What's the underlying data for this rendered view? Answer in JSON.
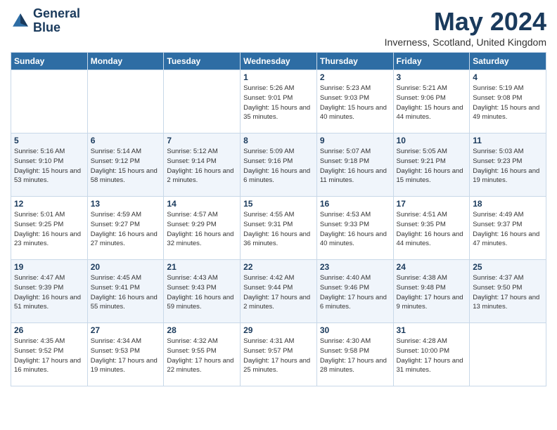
{
  "header": {
    "logo_line1": "General",
    "logo_line2": "Blue",
    "month_title": "May 2024",
    "location": "Inverness, Scotland, United Kingdom"
  },
  "days_of_week": [
    "Sunday",
    "Monday",
    "Tuesday",
    "Wednesday",
    "Thursday",
    "Friday",
    "Saturday"
  ],
  "weeks": [
    [
      {
        "day": "",
        "info": ""
      },
      {
        "day": "",
        "info": ""
      },
      {
        "day": "",
        "info": ""
      },
      {
        "day": "1",
        "info": "Sunrise: 5:26 AM\nSunset: 9:01 PM\nDaylight: 15 hours\nand 35 minutes."
      },
      {
        "day": "2",
        "info": "Sunrise: 5:23 AM\nSunset: 9:03 PM\nDaylight: 15 hours\nand 40 minutes."
      },
      {
        "day": "3",
        "info": "Sunrise: 5:21 AM\nSunset: 9:06 PM\nDaylight: 15 hours\nand 44 minutes."
      },
      {
        "day": "4",
        "info": "Sunrise: 5:19 AM\nSunset: 9:08 PM\nDaylight: 15 hours\nand 49 minutes."
      }
    ],
    [
      {
        "day": "5",
        "info": "Sunrise: 5:16 AM\nSunset: 9:10 PM\nDaylight: 15 hours\nand 53 minutes."
      },
      {
        "day": "6",
        "info": "Sunrise: 5:14 AM\nSunset: 9:12 PM\nDaylight: 15 hours\nand 58 minutes."
      },
      {
        "day": "7",
        "info": "Sunrise: 5:12 AM\nSunset: 9:14 PM\nDaylight: 16 hours\nand 2 minutes."
      },
      {
        "day": "8",
        "info": "Sunrise: 5:09 AM\nSunset: 9:16 PM\nDaylight: 16 hours\nand 6 minutes."
      },
      {
        "day": "9",
        "info": "Sunrise: 5:07 AM\nSunset: 9:18 PM\nDaylight: 16 hours\nand 11 minutes."
      },
      {
        "day": "10",
        "info": "Sunrise: 5:05 AM\nSunset: 9:21 PM\nDaylight: 16 hours\nand 15 minutes."
      },
      {
        "day": "11",
        "info": "Sunrise: 5:03 AM\nSunset: 9:23 PM\nDaylight: 16 hours\nand 19 minutes."
      }
    ],
    [
      {
        "day": "12",
        "info": "Sunrise: 5:01 AM\nSunset: 9:25 PM\nDaylight: 16 hours\nand 23 minutes."
      },
      {
        "day": "13",
        "info": "Sunrise: 4:59 AM\nSunset: 9:27 PM\nDaylight: 16 hours\nand 27 minutes."
      },
      {
        "day": "14",
        "info": "Sunrise: 4:57 AM\nSunset: 9:29 PM\nDaylight: 16 hours\nand 32 minutes."
      },
      {
        "day": "15",
        "info": "Sunrise: 4:55 AM\nSunset: 9:31 PM\nDaylight: 16 hours\nand 36 minutes."
      },
      {
        "day": "16",
        "info": "Sunrise: 4:53 AM\nSunset: 9:33 PM\nDaylight: 16 hours\nand 40 minutes."
      },
      {
        "day": "17",
        "info": "Sunrise: 4:51 AM\nSunset: 9:35 PM\nDaylight: 16 hours\nand 44 minutes."
      },
      {
        "day": "18",
        "info": "Sunrise: 4:49 AM\nSunset: 9:37 PM\nDaylight: 16 hours\nand 47 minutes."
      }
    ],
    [
      {
        "day": "19",
        "info": "Sunrise: 4:47 AM\nSunset: 9:39 PM\nDaylight: 16 hours\nand 51 minutes."
      },
      {
        "day": "20",
        "info": "Sunrise: 4:45 AM\nSunset: 9:41 PM\nDaylight: 16 hours\nand 55 minutes."
      },
      {
        "day": "21",
        "info": "Sunrise: 4:43 AM\nSunset: 9:43 PM\nDaylight: 16 hours\nand 59 minutes."
      },
      {
        "day": "22",
        "info": "Sunrise: 4:42 AM\nSunset: 9:44 PM\nDaylight: 17 hours\nand 2 minutes."
      },
      {
        "day": "23",
        "info": "Sunrise: 4:40 AM\nSunset: 9:46 PM\nDaylight: 17 hours\nand 6 minutes."
      },
      {
        "day": "24",
        "info": "Sunrise: 4:38 AM\nSunset: 9:48 PM\nDaylight: 17 hours\nand 9 minutes."
      },
      {
        "day": "25",
        "info": "Sunrise: 4:37 AM\nSunset: 9:50 PM\nDaylight: 17 hours\nand 13 minutes."
      }
    ],
    [
      {
        "day": "26",
        "info": "Sunrise: 4:35 AM\nSunset: 9:52 PM\nDaylight: 17 hours\nand 16 minutes."
      },
      {
        "day": "27",
        "info": "Sunrise: 4:34 AM\nSunset: 9:53 PM\nDaylight: 17 hours\nand 19 minutes."
      },
      {
        "day": "28",
        "info": "Sunrise: 4:32 AM\nSunset: 9:55 PM\nDaylight: 17 hours\nand 22 minutes."
      },
      {
        "day": "29",
        "info": "Sunrise: 4:31 AM\nSunset: 9:57 PM\nDaylight: 17 hours\nand 25 minutes."
      },
      {
        "day": "30",
        "info": "Sunrise: 4:30 AM\nSunset: 9:58 PM\nDaylight: 17 hours\nand 28 minutes."
      },
      {
        "day": "31",
        "info": "Sunrise: 4:28 AM\nSunset: 10:00 PM\nDaylight: 17 hours\nand 31 minutes."
      },
      {
        "day": "",
        "info": ""
      }
    ]
  ]
}
